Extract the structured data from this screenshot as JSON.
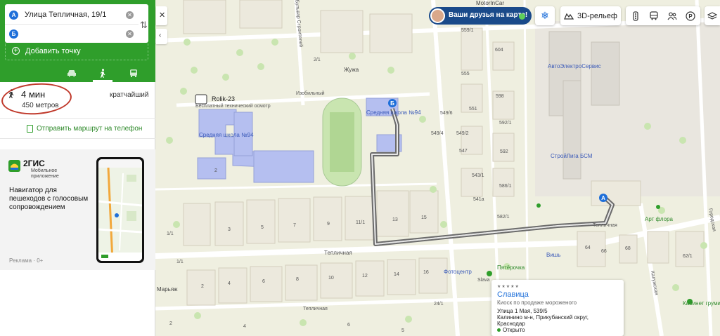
{
  "route_panel": {
    "point_a_letter": "А",
    "point_a_value": "Улица Тепличная, 19/1",
    "point_b_letter": "Б",
    "point_b_value": "",
    "add_point_label": "Добавить точку",
    "transport_modes": [
      "car",
      "pedestrian",
      "bus"
    ],
    "active_mode": "pedestrian"
  },
  "result": {
    "time": "4 мин",
    "distance": "450 метров",
    "tag": "кратчайший"
  },
  "send_phone_label": "Отправить маршрут на телефон",
  "ad": {
    "brand": "2ГИС",
    "sub1": "Мобильное",
    "sub2": "приложение",
    "text": "Навигатор для пешеходов с голосовым сопровождением",
    "label": "Реклама · 0+"
  },
  "controls": {
    "friends_label": "Ваши друзья на карте!",
    "relief_label": "3D-рельеф"
  },
  "colors": {
    "brand_green": "#2f9e2b",
    "route_line": "#333333",
    "pin_blue": "#1e6fd9",
    "school_fill": "#b5bff0",
    "park_fill": "#c9e5b0",
    "building_fill": "#ece9dd"
  },
  "map": {
    "street_labels": [
      "Изобильный",
      "Тепличная",
      "Тепличная",
      "Тепличная",
      "Калужская",
      "Городская",
      "Бульвар Строителей"
    ],
    "poi_labels": [
      "Rolik-23",
      "Бесплатный технический осмотр",
      "Средняя школа №94",
      "Средняя школа №94",
      "АвтоЭлектроСервис",
      "СтройЛига БСМ",
      "Арт флора",
      "Фотоцентр",
      "Пятёрочка",
      "Вишь",
      "Жужа",
      "MotorInCar",
      "Кабинет груминга",
      "Марьяж",
      "Slava"
    ],
    "house_numbers": [
      "559/1",
      "604",
      "555",
      "598",
      "551",
      "549/6",
      "549/4",
      "549/2",
      "547",
      "543/1",
      "586/1",
      "541a",
      "592/1",
      "592",
      "582/1",
      "2/1",
      "1/1",
      "2",
      "3",
      "5",
      "7",
      "9",
      "11/1",
      "13",
      "15",
      "64",
      "66",
      "68",
      "62/1",
      "1/1",
      "2",
      "4",
      "6",
      "8",
      "10",
      "12",
      "14",
      "16",
      "24/1",
      "2",
      "4",
      "6",
      "5"
    ]
  },
  "popup": {
    "stars": "★★★★★",
    "title": "Славица",
    "category": "Киоск по продаже мороженого",
    "address_line1": "Улица 1 Мая, 539/5",
    "address_line2": "Калинино м-н, Прикубанский округ,",
    "address_line3": "Краснодар",
    "status": "Открыто"
  }
}
